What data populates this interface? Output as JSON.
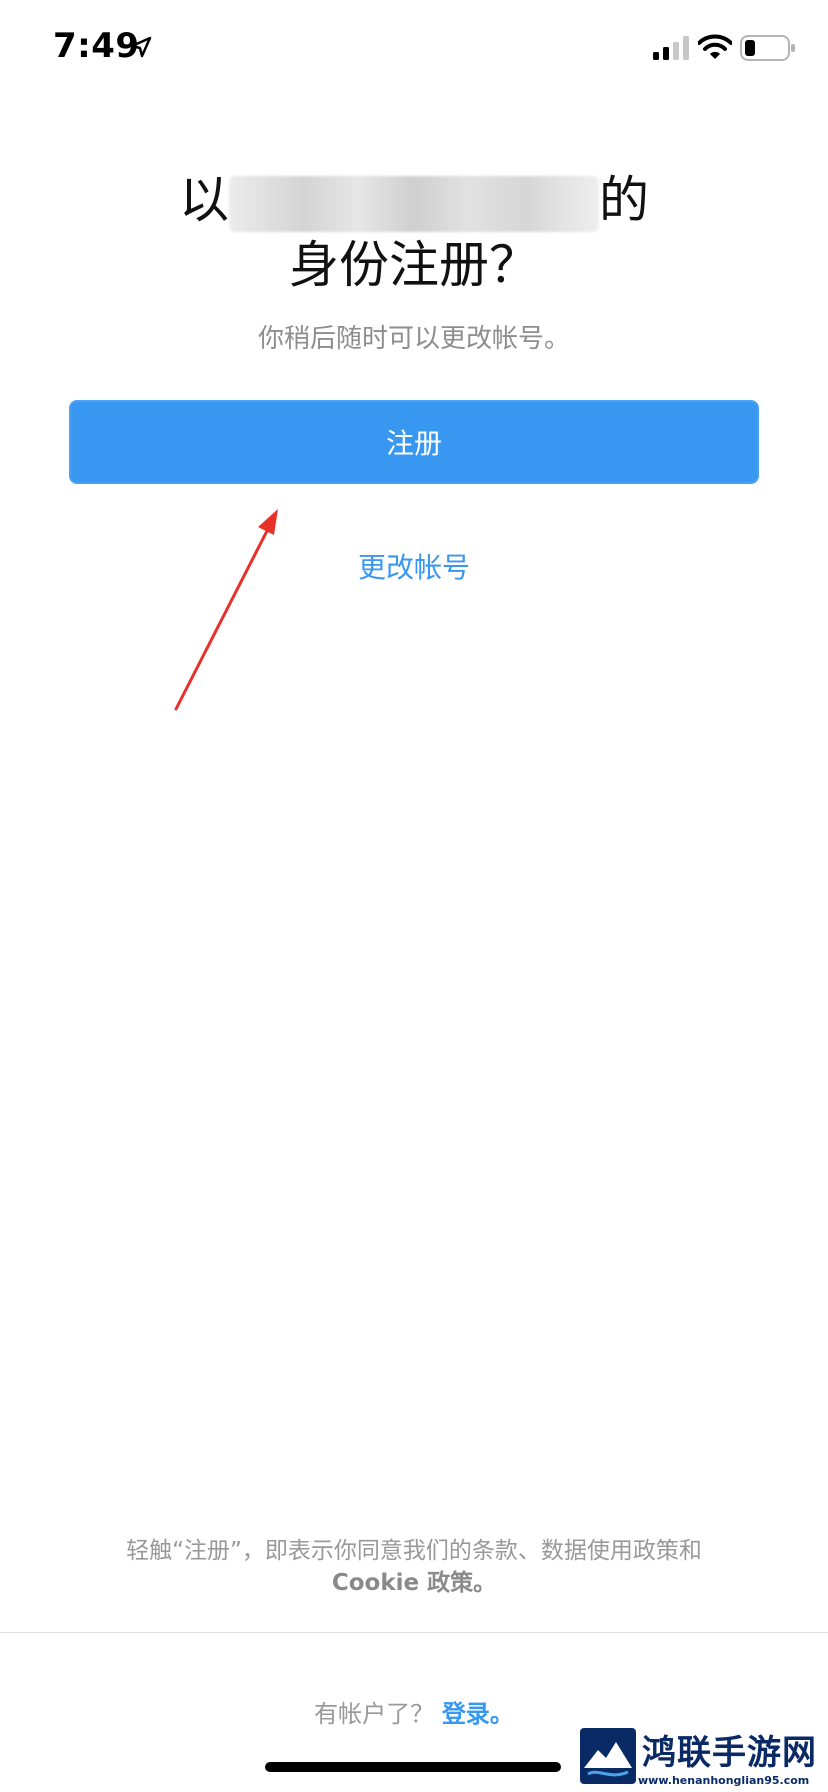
{
  "status_bar": {
    "time": "7:49",
    "icons": [
      "location-arrow-icon",
      "cellular-signal-icon",
      "wifi-icon",
      "battery-icon"
    ]
  },
  "header": {
    "title_prefix": "以",
    "title_suffix": "的",
    "title_line2": "身份注册？",
    "subtitle": "你稍后随时可以更改帐号。"
  },
  "actions": {
    "register_label": "注册",
    "change_account_label": "更改帐号"
  },
  "footer": {
    "terms_line1": "轻触“注册”，即表示你同意我们的条款、数据使用政策和",
    "terms_line2": "Cookie 政策。",
    "login_prompt": "有帐户了？",
    "login_link": "登录。"
  },
  "watermark": {
    "title": "鸿联手游网",
    "url": "www.henanhonglian95.com"
  },
  "colors": {
    "accent": "#3897f0",
    "annotation_arrow": "#e8302a",
    "secondary_text": "#8e8e8e"
  }
}
